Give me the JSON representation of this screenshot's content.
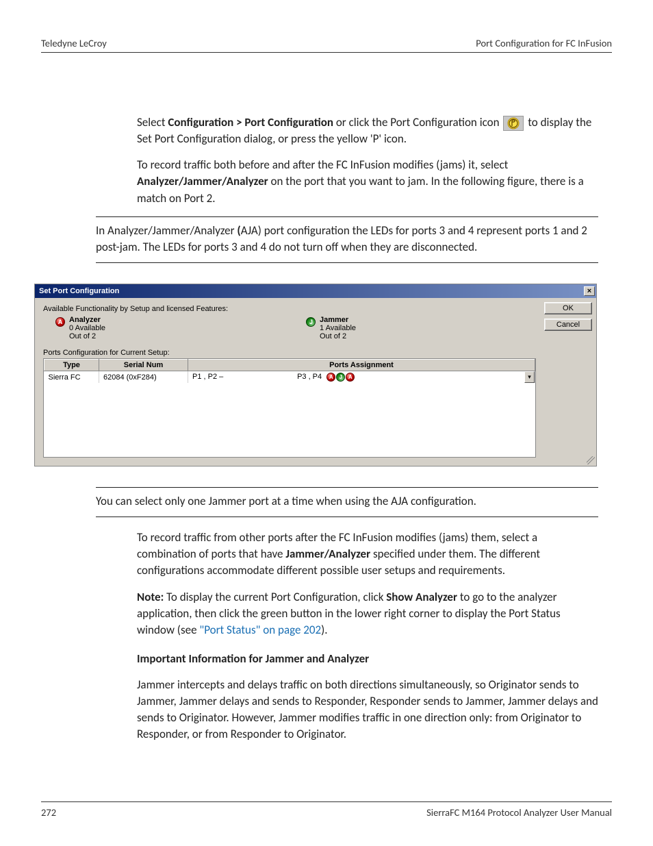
{
  "header": {
    "left": "Teledyne LeCroy",
    "right": "Port Configuration for FC InFusion"
  },
  "para1_a": "Select ",
  "para1_b": "Configuration > Port Configuration",
  "para1_c": " or click the Port Configuration icon ",
  "para1_d": " to display the Set Port Configuration dialog, or press the yellow 'P' icon.",
  "para2_a": "To record traffic both before and after the FC InFusion modifies (jams) it, select ",
  "para2_b": "Analyzer/Jammer/Analyzer",
  "para2_c": " on the port that you want to jam. In the following figure, there is a match on Port 2.",
  "note1_a": "In Analyzer/Jammer/Analyzer ",
  "note1_b": "(",
  "note1_c": "AJA) port configuration the LEDs for ports 3 and 4 represent ports 1 and 2 post-jam. The LEDs for ports 3 and 4 do not turn off when they are disconnected.",
  "dialog": {
    "title": "Set Port Configuration",
    "close": "×",
    "ok": "OK",
    "cancel": "Cancel",
    "avail_head": "Available Functionality by Setup and licensed Features:",
    "analyzer": {
      "title": "Analyzer",
      "l1": "0 Available",
      "l2": "Out of 2",
      "badge": "A"
    },
    "jammer": {
      "title": "Jammer",
      "l1": "1 Available",
      "l2": "Out of 2",
      "badge": "J"
    },
    "ports_head": "Ports Configuration for Current Setup:",
    "cols": {
      "type": "Type",
      "serial": "Serial Num",
      "ports": "Ports Assignment"
    },
    "row": {
      "type": "Sierra FC",
      "serial": "62084 (0xF284)",
      "p12": "P1 , P2     –",
      "p34": "P3 , P4"
    }
  },
  "note2": "You can select only one Jammer port at a time when using the AJA configuration.",
  "para3_a": "To record traffic from other ports after the FC InFusion modifies (jams) them, select a combination of ports that have ",
  "para3_b": "Jammer/Analyzer",
  "para3_c": " specified under them. The different configurations accommodate different possible user setups and requirements.",
  "para4_a": "Note:",
  "para4_b": " To display the current Port Configuration, click ",
  "para4_c": "Show Analyzer",
  "para4_d": " to go to the analyzer application, then click the green button in the lower right corner to display the Port Status window (see ",
  "para4_link": "\"Port Status\" on page 202",
  "para4_e": ").",
  "subheading": "Important Information for Jammer and Analyzer",
  "para5": "Jammer intercepts and delays traffic on both directions simultaneously, so Originator sends to Jammer, Jammer delays and sends to Responder, Responder sends to Jammer, Jammer delays and sends to Originator. However, Jammer modifies traffic in one direction only: from Originator to Responder, or from Responder to Originator.",
  "footer": {
    "page": "272",
    "doc": "SierraFC M164 Protocol Analyzer User Manual"
  }
}
